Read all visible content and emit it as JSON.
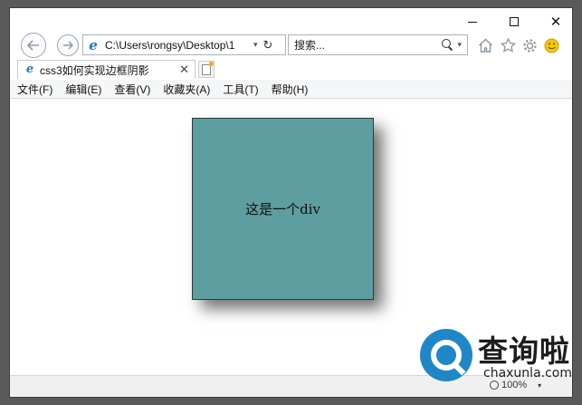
{
  "window": {
    "controls": {
      "minimize": "",
      "maximize": "",
      "close": "✕"
    }
  },
  "navbar": {
    "back_icon": "back-arrow-icon",
    "forward_icon": "forward-arrow-icon",
    "address": "C:\\Users\\rongsy\\Desktop\\1",
    "search_placeholder": "搜索...",
    "refresh_glyph": "↻",
    "dropdown_glyph": "▾",
    "toolbar_icons": [
      "home-icon",
      "star-icon",
      "gear-icon",
      "smiley-icon"
    ]
  },
  "tabs": [
    {
      "title": "css3如何实现边框阴影",
      "close": "✕"
    }
  ],
  "menubar": {
    "items": [
      "文件(F)",
      "编辑(E)",
      "查看(V)",
      "收藏夹(A)",
      "工具(T)",
      "帮助(H)"
    ]
  },
  "content": {
    "box_text": "这是一个div",
    "box_color": "#5f9ea0"
  },
  "statusbar": {
    "zoom": "100%"
  },
  "watermark": {
    "title": "查询啦",
    "url": "chaxunla.com",
    "brand_color": "#1f86c8"
  }
}
